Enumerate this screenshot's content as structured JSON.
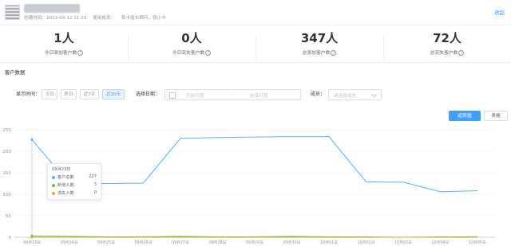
{
  "header": {
    "meta": [
      "创建时间：2022-04-12 11:29",
      "使用成员：",
      "锁卡增长顾问，锁小卡"
    ],
    "collapse_label": "收起"
  },
  "stats": [
    {
      "value": "1人",
      "label": "今日添加客户数"
    },
    {
      "value": "0人",
      "label": "今日流失客户数"
    },
    {
      "value": "347人",
      "label": "总添加客户数"
    },
    {
      "value": "72人",
      "label": "总流失客户数"
    }
  ],
  "section_title": "客户数据",
  "filters": {
    "time_label": "显示时间：",
    "time_buttons": [
      "今日",
      "昨日",
      "近7天",
      "近30天"
    ],
    "active_time": "近30天",
    "date_label": "选择日期：",
    "start_placeholder": "开始日期",
    "range_separator": "-",
    "end_placeholder": "结束日期",
    "member_label": "成员：",
    "member_placeholder": "请选择成员"
  },
  "view_toggle": {
    "trend": "趋势图",
    "table": "表格"
  },
  "colors": {
    "accent": "#409eff",
    "total": "#5ab1ef",
    "new": "#67c23a",
    "lost": "#e6a23c"
  },
  "chart_data": {
    "type": "line",
    "x": [
      "09月23日",
      "09月24日",
      "09月25日",
      "09月26日",
      "09月27日",
      "09月28日",
      "09月29日",
      "09月30日",
      "10月01日",
      "10月02日",
      "10月03日",
      "10月04日",
      "10月05日"
    ],
    "series": [
      {
        "name": "客户总数",
        "color": "#5ab1ef",
        "values": [
          227,
          125,
          125,
          126,
          230,
          232,
          233,
          234,
          234,
          129,
          128,
          106,
          108
        ]
      },
      {
        "name": "新增人数",
        "color": "#67c23a",
        "values": [
          3,
          2,
          1,
          1,
          2,
          1,
          1,
          2,
          1,
          1,
          0,
          1,
          1
        ]
      },
      {
        "name": "流失人数",
        "color": "#e6a23c",
        "values": [
          0,
          0,
          0,
          0,
          0,
          0,
          0,
          0,
          0,
          0,
          0,
          0,
          0
        ]
      }
    ],
    "ylim": [
      0,
      250
    ],
    "yticks": [
      0,
      50,
      100,
      150,
      200,
      250
    ],
    "grid": true,
    "tooltip": {
      "date": "09月23日",
      "rows": [
        {
          "name": "客户总数",
          "value": "227"
        },
        {
          "name": "新增人数",
          "value": "3"
        },
        {
          "name": "流失人数",
          "value": "0"
        }
      ]
    }
  }
}
